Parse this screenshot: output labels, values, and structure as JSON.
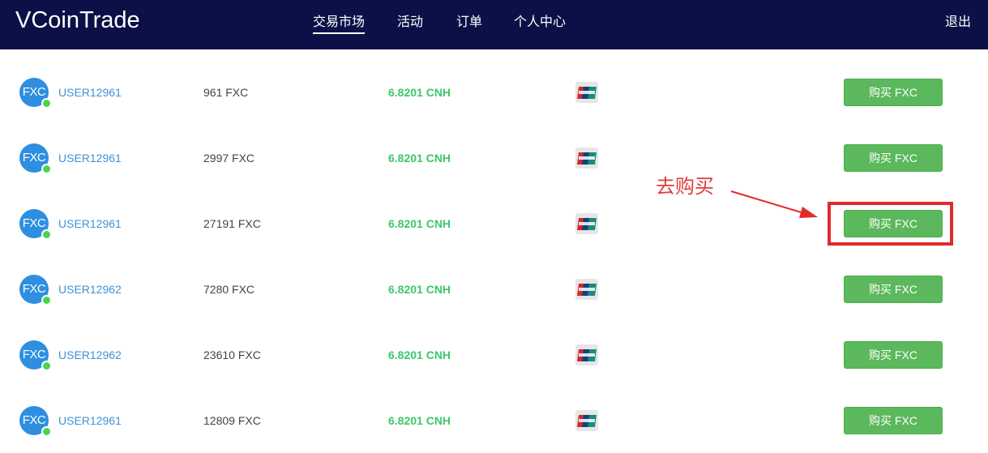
{
  "header": {
    "logo": "VCoinTrade",
    "nav": [
      "交易市场",
      "活动",
      "订单",
      "个人中心"
    ],
    "logout": "退出"
  },
  "listings": [
    {
      "avatar": "FXC",
      "user": "USER12961",
      "amount": "961 FXC",
      "price": "6.8201 CNH",
      "payment": "unionpay-icon",
      "button": "购买 FXC"
    },
    {
      "avatar": "FXC",
      "user": "USER12961",
      "amount": "2997 FXC",
      "price": "6.8201 CNH",
      "payment": "unionpay-icon",
      "button": "购买 FXC"
    },
    {
      "avatar": "FXC",
      "user": "USER12961",
      "amount": "27191 FXC",
      "price": "6.8201 CNH",
      "payment": "unionpay-icon",
      "button": "购买 FXC"
    },
    {
      "avatar": "FXC",
      "user": "USER12962",
      "amount": "7280 FXC",
      "price": "6.8201 CNH",
      "payment": "unionpay-icon",
      "button": "购买 FXC"
    },
    {
      "avatar": "FXC",
      "user": "USER12962",
      "amount": "23610 FXC",
      "price": "6.8201 CNH",
      "payment": "unionpay-icon",
      "button": "购买 FXC"
    },
    {
      "avatar": "FXC",
      "user": "USER12961",
      "amount": "12809 FXC",
      "price": "6.8201 CNH",
      "payment": "unionpay-icon",
      "button": "购买 FXC"
    }
  ],
  "annotation": {
    "text": "去购买",
    "color": "#e13d3d"
  },
  "colors": {
    "header_bg": "#0b1146",
    "buy_button": "#5cb85c",
    "price": "#3cc76a",
    "username": "#3f92d6",
    "avatar": "#2e8fe0",
    "online": "#4cd34c"
  }
}
